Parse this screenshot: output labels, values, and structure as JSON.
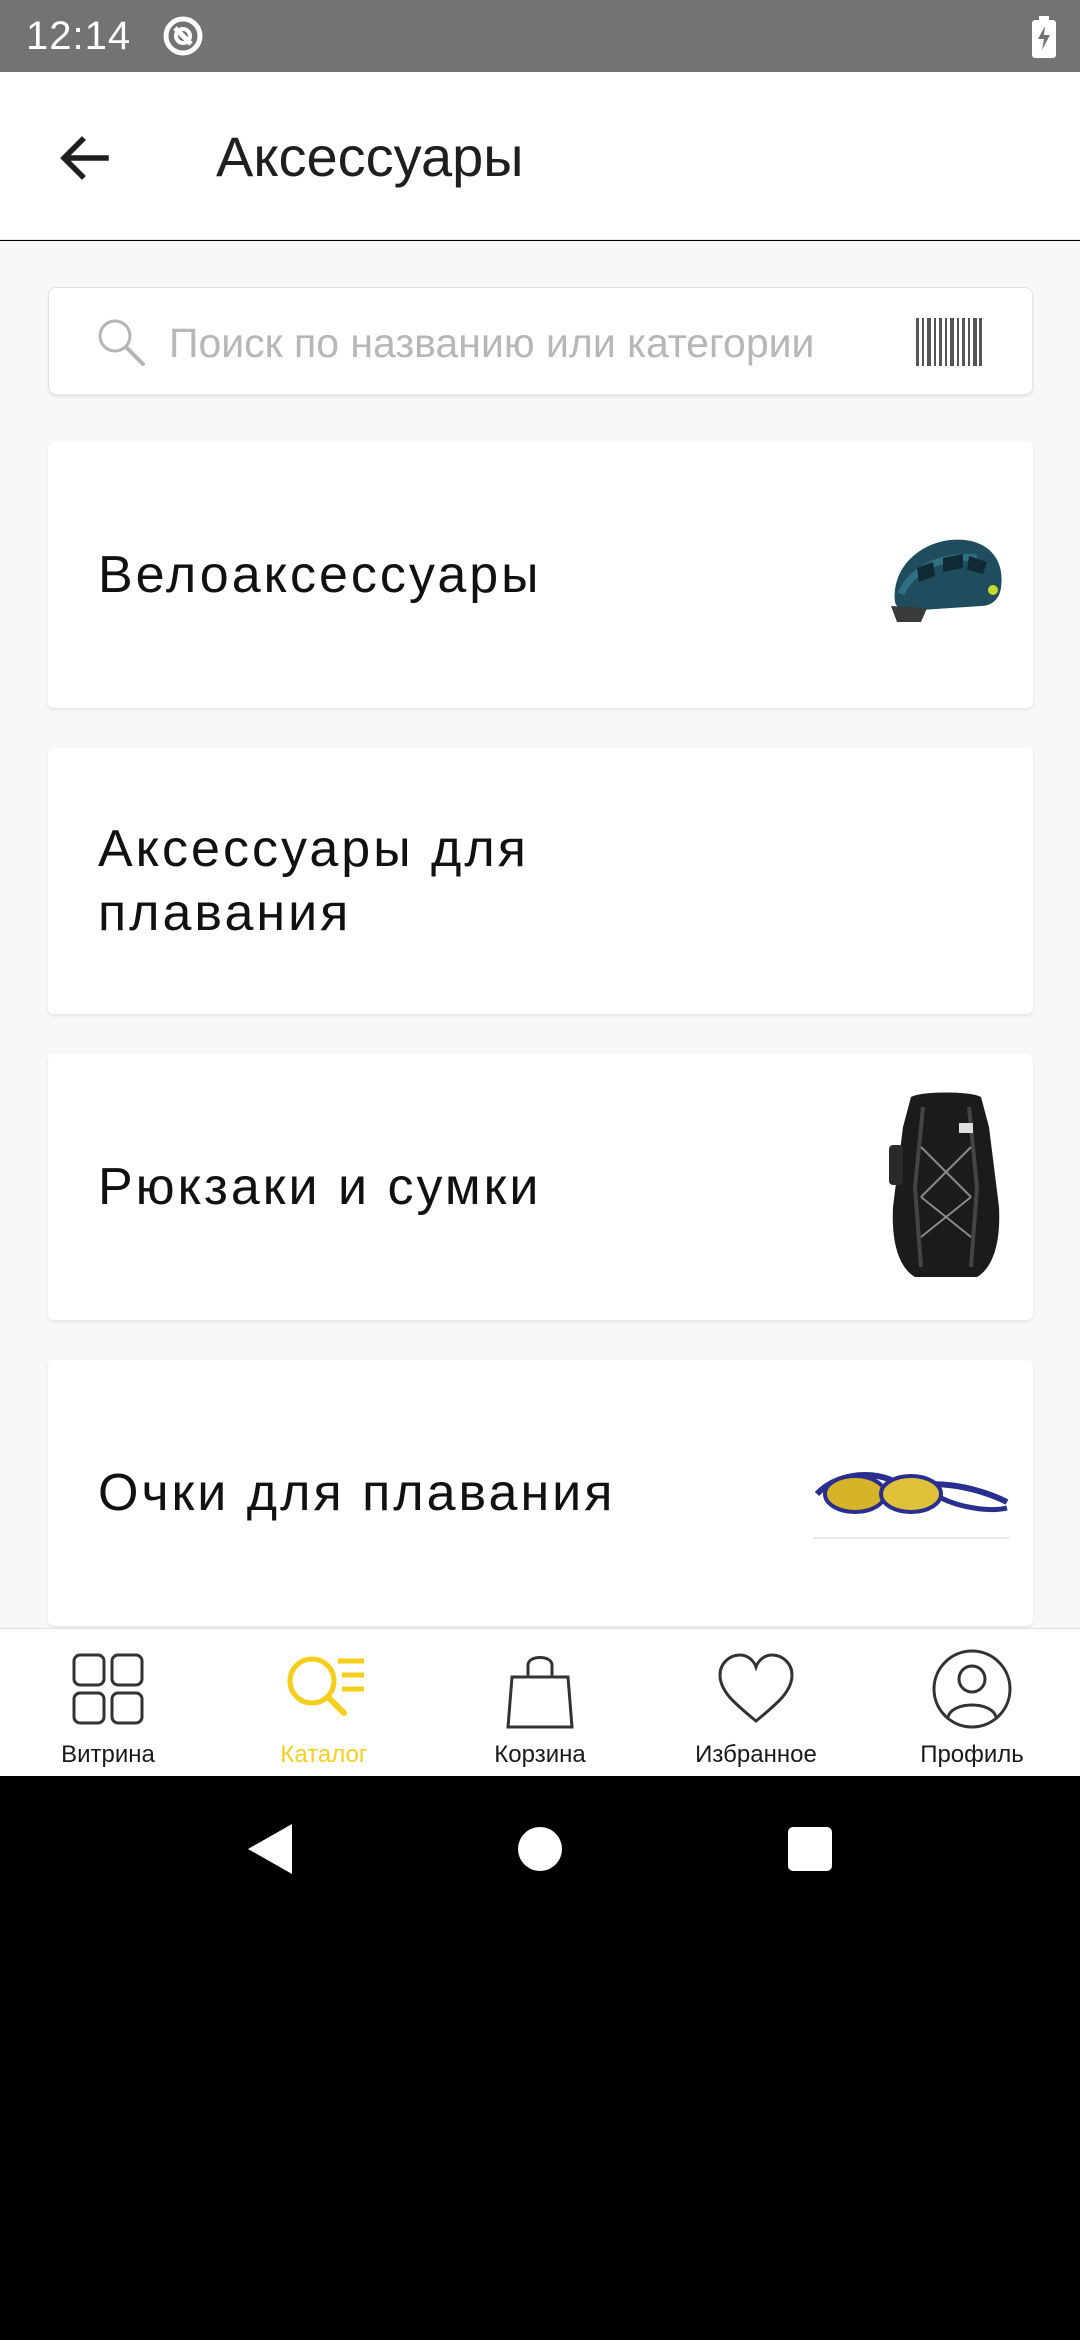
{
  "status_bar": {
    "time": "12:14",
    "icons": [
      "sync-icon",
      "battery-charging-icon"
    ]
  },
  "app_bar": {
    "title": "Аксессуары",
    "back_icon": "arrow-left-icon"
  },
  "search": {
    "placeholder": "Поиск по названию или категории",
    "icons": [
      "search-icon",
      "barcode-icon"
    ]
  },
  "categories": [
    {
      "label": "Велоаксессуары",
      "image": "bike-helmet-image"
    },
    {
      "label": "Аксессуары для плавания",
      "image": ""
    },
    {
      "label": "Рюкзаки и сумки",
      "image": "backpack-image"
    },
    {
      "label": "Очки для плавания",
      "image": "swim-goggles-image"
    }
  ],
  "bottom_nav": {
    "items": [
      {
        "label": "Витрина",
        "icon": "grid-icon",
        "active": false
      },
      {
        "label": "Каталог",
        "icon": "catalog-search-icon",
        "active": true
      },
      {
        "label": "Корзина",
        "icon": "shopping-bag-icon",
        "active": false
      },
      {
        "label": "Избранное",
        "icon": "heart-icon",
        "active": false
      },
      {
        "label": "Профиль",
        "icon": "profile-icon",
        "active": false
      }
    ],
    "active_color": "#F5CF1B"
  },
  "system_nav": [
    "back-triangle-icon",
    "home-circle-icon",
    "recents-square-icon"
  ]
}
